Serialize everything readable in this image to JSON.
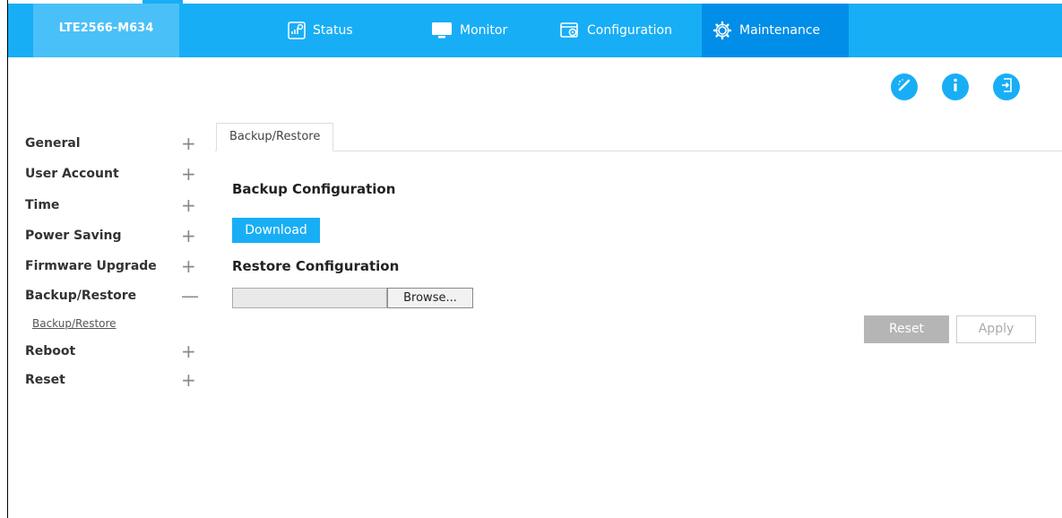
{
  "header": {
    "device_name": "LTE2566-M634",
    "nav": [
      {
        "label": "Status",
        "icon": "status-icon"
      },
      {
        "label": "Monitor",
        "icon": "monitor-icon"
      },
      {
        "label": "Configuration",
        "icon": "configuration-icon"
      },
      {
        "label": "Maintenance",
        "icon": "maintenance-gear-icon",
        "active": true
      }
    ],
    "actions": [
      {
        "icon": "wizard-icon"
      },
      {
        "icon": "info-icon"
      },
      {
        "icon": "logout-icon"
      }
    ]
  },
  "sidebar": {
    "items": [
      {
        "label": "General",
        "sign": "+"
      },
      {
        "label": "User Account",
        "sign": "+"
      },
      {
        "label": "Time",
        "sign": "+"
      },
      {
        "label": "Power Saving",
        "sign": "+"
      },
      {
        "label": "Firmware Upgrade",
        "sign": "+"
      },
      {
        "label": "Backup/Restore",
        "sign": "—"
      },
      {
        "label": "Reboot",
        "sign": "+"
      },
      {
        "label": "Reset",
        "sign": "+"
      }
    ],
    "subitem": "Backup/Restore"
  },
  "main": {
    "tab": "Backup/Restore",
    "backup_title": "Backup Configuration",
    "download_label": "Download",
    "restore_title": "Restore Configuration",
    "file_value": "",
    "browse_label": "Browse...",
    "reset_label": "Reset",
    "apply_label": "Apply"
  },
  "colors": {
    "accent": "#18aef6",
    "active_nav": "#008ee8",
    "disabled_button": "#b5b5b5"
  }
}
